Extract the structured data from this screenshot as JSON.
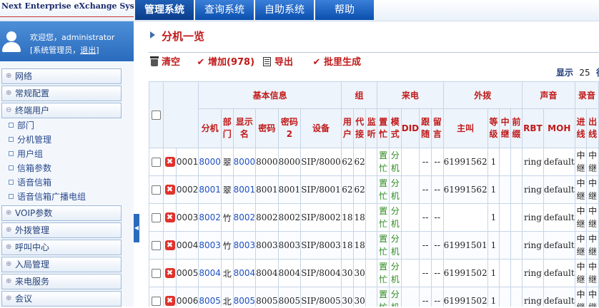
{
  "app_title": "Next Enterprise eXchange System",
  "nav_tabs": [
    {
      "label": "管理系统",
      "active": true
    },
    {
      "label": "查询系统",
      "active": false
    },
    {
      "label": "自助系统",
      "active": false
    },
    {
      "label": "帮助",
      "active": false
    }
  ],
  "user": {
    "welcome": "欢迎您，administrator",
    "role": "[系统管理员，",
    "logout": "退出",
    "close": "]"
  },
  "menu": {
    "net": "网络",
    "common": "常规配置",
    "terminal_users": "终端用户",
    "terminal_sub": [
      "部门",
      "分机管理",
      "用户组",
      "信箱参数",
      "语音信箱",
      "语音信箱广播电组"
    ],
    "voip": "VOIP参数",
    "outbound": "外拨管理",
    "callcenter": "呼叫中心",
    "inbound": "入局管理",
    "incoming": "来电服务",
    "meeting": "会议"
  },
  "page_title": "分机一览",
  "toolbar": {
    "clear": "清空",
    "add": "增加(978)",
    "export": "导出",
    "batch": "批里生成"
  },
  "display": {
    "label": "显示",
    "count": "25",
    "suffix": "行"
  },
  "table": {
    "groups": {
      "basic": "基本信息",
      "group": "组",
      "incoming": "来电",
      "outbound": "外拨",
      "sound": "声音",
      "record": "录音"
    },
    "columns": {
      "ext": "分机",
      "dept": "部门",
      "display_name": "显示名",
      "pwd": "密码",
      "pwd2": "密码2",
      "device": "设备",
      "user": "用户",
      "proxy": "代接",
      "monitor": "监听",
      "busy": "置忙",
      "mode": "模式",
      "did": "DID",
      "follow": "跟随",
      "msg": "留言",
      "caller": "主叫",
      "level": "等级",
      "relay": "中继",
      "prefix": "前缀",
      "rbt": "RBT",
      "moh": "MOH",
      "rec_in": "进线",
      "rec_out": "出线"
    },
    "rows": [
      {
        "idx": "0001",
        "ext": "8000",
        "dept": "翠",
        "name": "8000",
        "pwd": "8000",
        "pwd2": "8000",
        "device": "SIP/8000",
        "user": "62",
        "proxy": "62",
        "busy": "置忙",
        "mode": "分机",
        "follow": "--",
        "msg": "--",
        "caller": "61991562",
        "level": "1",
        "rbt": "ring",
        "moh": "default",
        "rec_in": "中继",
        "rec_out": "中继"
      },
      {
        "idx": "0002",
        "ext": "8001",
        "dept": "翠",
        "name": "8001",
        "pwd": "8001",
        "pwd2": "8001",
        "device": "SIP/8001",
        "user": "62",
        "proxy": "62",
        "busy": "置忙",
        "mode": "分机",
        "follow": "--",
        "msg": "--",
        "caller": "61991562",
        "level": "1",
        "rbt": "ring",
        "moh": "default",
        "rec_in": "中继",
        "rec_out": "中继"
      },
      {
        "idx": "0003",
        "ext": "8002",
        "dept": "竹",
        "name": "8002",
        "pwd": "8002",
        "pwd2": "8002",
        "device": "SIP/8002",
        "user": "18",
        "proxy": "18",
        "busy": "置忙",
        "mode": "分机",
        "follow": "--",
        "msg": "--",
        "caller": "",
        "level": "1",
        "rbt": "ring",
        "moh": "default",
        "rec_in": "中继",
        "rec_out": "中继"
      },
      {
        "idx": "0004",
        "ext": "8003",
        "dept": "竹",
        "name": "8003",
        "pwd": "8003",
        "pwd2": "8003",
        "device": "SIP/8003",
        "user": "18",
        "proxy": "18",
        "busy": "置忙",
        "mode": "分机",
        "follow": "--",
        "msg": "--",
        "caller": "61991501",
        "level": "1",
        "rbt": "ring",
        "moh": "default",
        "rec_in": "中继",
        "rec_out": "中继"
      },
      {
        "idx": "0005",
        "ext": "8004",
        "dept": "北",
        "name": "8004",
        "pwd": "8004",
        "pwd2": "8004",
        "device": "SIP/8004",
        "user": "30",
        "proxy": "30",
        "busy": "置忙",
        "mode": "分机",
        "follow": "--",
        "msg": "--",
        "caller": "61991502",
        "level": "1",
        "rbt": "ring",
        "moh": "default",
        "rec_in": "中继",
        "rec_out": "中继"
      },
      {
        "idx": "0006",
        "ext": "8005",
        "dept": "北",
        "name": "8005",
        "pwd": "8005",
        "pwd2": "8005",
        "device": "SIP/8005",
        "user": "30",
        "proxy": "30",
        "busy": "置忙",
        "mode": "分机",
        "follow": "--",
        "msg": "--",
        "caller": "61991502",
        "level": "1",
        "rbt": "ring",
        "moh": "default",
        "rec_in": "中继",
        "rec_out": "中继"
      }
    ]
  }
}
